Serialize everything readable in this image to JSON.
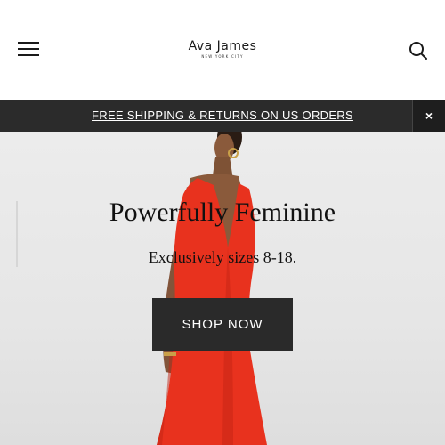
{
  "header": {
    "logo_name": "Ava James",
    "logo_sub": "NEW YORK CITY",
    "menu_icon": "hamburger-menu-icon",
    "search_icon": "search-icon"
  },
  "promo": {
    "text": "FREE SHIPPING & RETURNS ON US ORDERS",
    "close_label": "×"
  },
  "hero": {
    "title": "Powerfully Feminine",
    "subtitle": "Exclusively sizes 8-18.",
    "cta_label": "SHOP NOW"
  },
  "colors": {
    "dress": "#e8321e",
    "bar": "#2b2b2b",
    "button": "#2a2a2a",
    "hero_bg": "#e8e8e8"
  }
}
